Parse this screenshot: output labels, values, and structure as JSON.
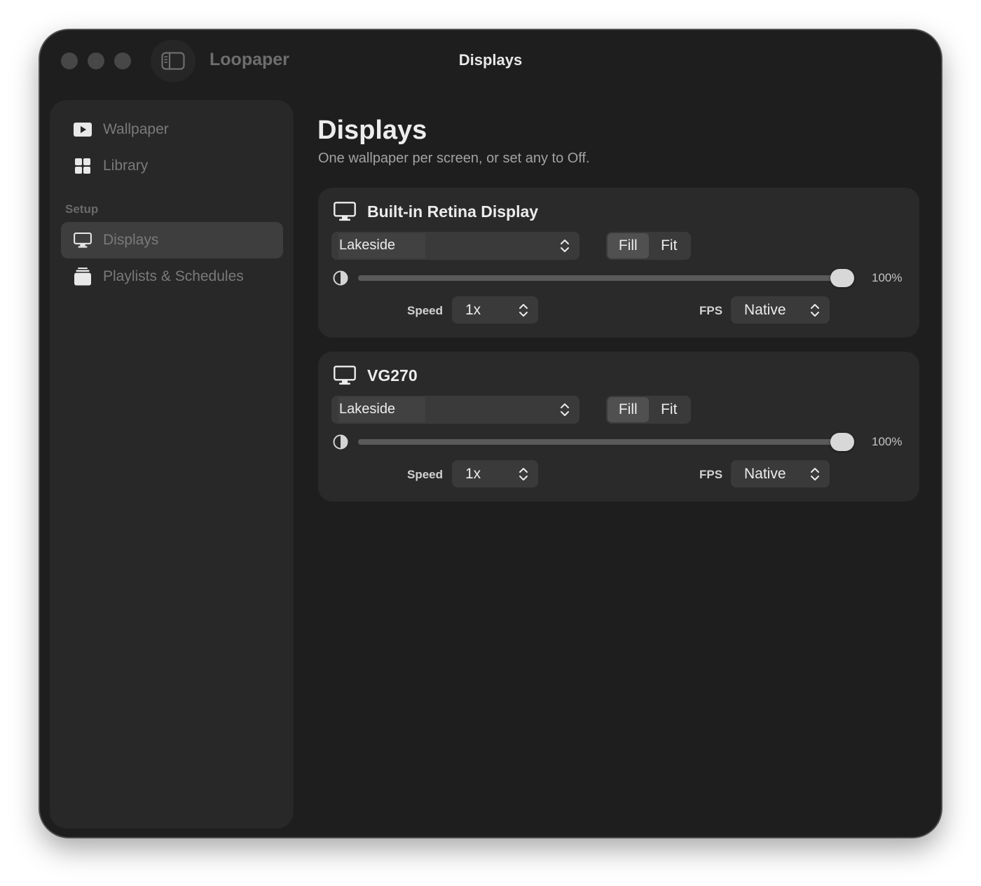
{
  "window": {
    "app_name": "Loopaper",
    "title": "Displays"
  },
  "sidebar": {
    "items": [
      {
        "label": "Wallpaper",
        "icon": "play-rectangle-icon"
      },
      {
        "label": "Library",
        "icon": "grid-icon"
      }
    ],
    "section_label": "Setup",
    "setup_items": [
      {
        "label": "Displays",
        "icon": "monitor-icon",
        "active": true
      },
      {
        "label": "Playlists & Schedules",
        "icon": "stack-icon",
        "active": false
      }
    ]
  },
  "main": {
    "title": "Displays",
    "subtitle": "One wallpaper per screen, or set any to Off.",
    "displays": [
      {
        "name": "Built-in Retina Display",
        "wallpaper": "Lakeside",
        "fill_label": "Fill",
        "fit_label": "Fit",
        "selected_mode": "Fill",
        "opacity": 1.0,
        "opacity_label": "100%",
        "speed_label": "Speed",
        "speed_value": "1x",
        "fps_label": "FPS",
        "fps_value": "Native"
      },
      {
        "name": "VG270",
        "wallpaper": "Lakeside",
        "fill_label": "Fill",
        "fit_label": "Fit",
        "selected_mode": "Fill",
        "opacity": 1.0,
        "opacity_label": "100%",
        "speed_label": "Speed",
        "speed_value": "1x",
        "fps_label": "FPS",
        "fps_value": "Native"
      }
    ]
  },
  "colors": {
    "window_bg": "#1e1e1e",
    "sidebar_bg": "#282828",
    "card_bg": "#2a2a2a",
    "active_item_bg": "#3e3e3e"
  }
}
